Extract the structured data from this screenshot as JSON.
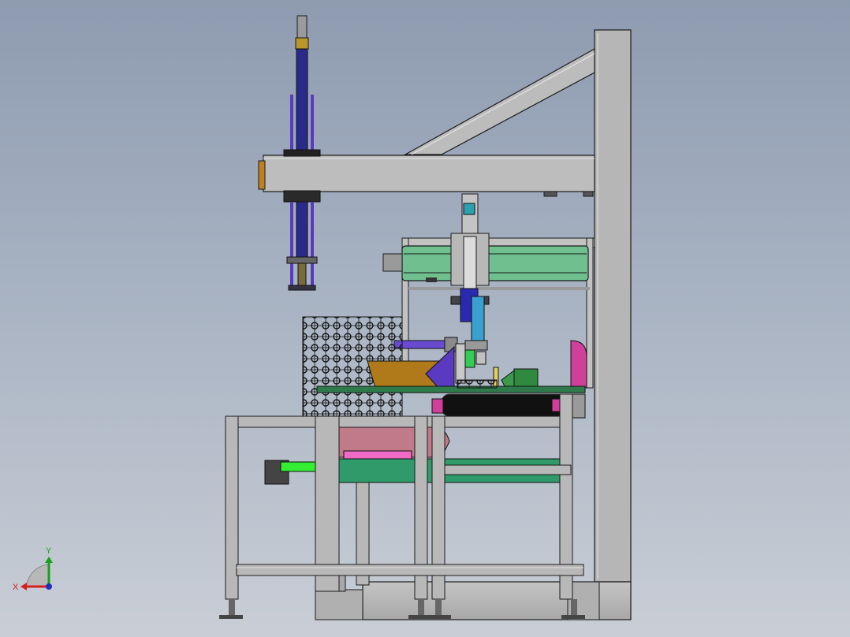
{
  "viewport": {
    "background_top": "#8e9bb0",
    "background_bottom": "#c9ced6"
  },
  "triad": {
    "x_label": "X",
    "y_label": "Y",
    "x_color": "#d42020",
    "y_color": "#1aa01a",
    "z_color": "#2030c0"
  },
  "colors": {
    "frame_gray": "#b4b4b4",
    "edge": "#1a1a1a",
    "cylinder_navy": "#2a2a8a",
    "rail_purple": "#5a3ac0",
    "belt_green": "#6fbf8f",
    "platform_green": "#2f9a6a",
    "magenta": "#d0409a",
    "brown": "#b07a1a",
    "cyan": "#3aa0d0",
    "bright_green": "#33ee33",
    "black_roller": "#111111"
  }
}
